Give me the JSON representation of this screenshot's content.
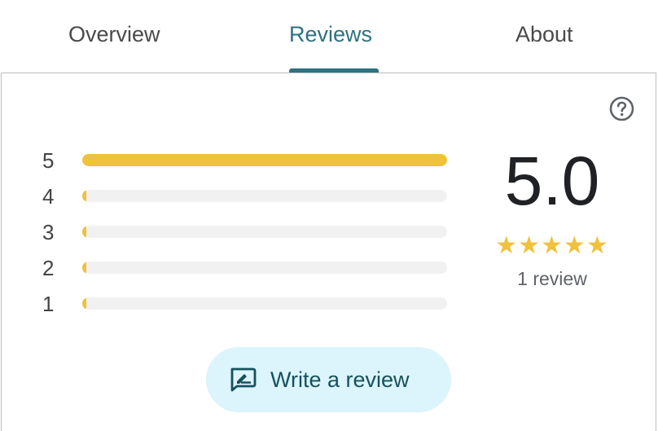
{
  "tabs": [
    {
      "label": "Overview",
      "active": false
    },
    {
      "label": "Reviews",
      "active": true
    },
    {
      "label": "About",
      "active": false
    }
  ],
  "rating": {
    "score": "5.0",
    "stars": "★★★★★",
    "stars_value": 5,
    "count_text": "1 review",
    "distribution": [
      {
        "label": "5",
        "fraction": 1.0
      },
      {
        "label": "4",
        "fraction": 0.0
      },
      {
        "label": "3",
        "fraction": 0.0
      },
      {
        "label": "2",
        "fraction": 0.0
      },
      {
        "label": "1",
        "fraction": 0.0
      }
    ]
  },
  "help_icon": "help-circle-icon",
  "write_review": {
    "label": "Write a review",
    "icon": "write-review-icon"
  },
  "colors": {
    "accent": "#2d7281",
    "star": "#f0c13c",
    "button_bg": "#dcf4fb",
    "button_text": "#15515d"
  }
}
